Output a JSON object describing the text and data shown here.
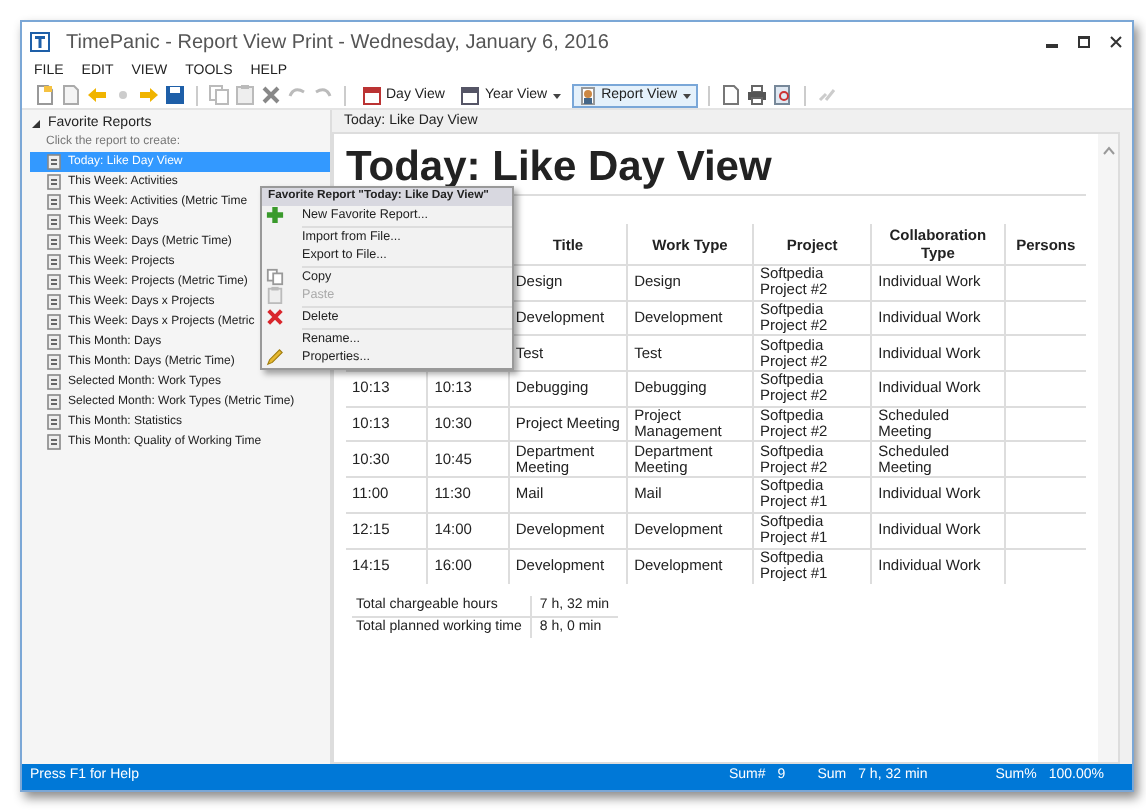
{
  "window": {
    "title": "TimePanic - Report View Print - Wednesday, January 6, 2016"
  },
  "menu_bar": [
    "FILE",
    "EDIT",
    "VIEW",
    "TOOLS",
    "HELP"
  ],
  "toolbar": {
    "view_buttons": [
      {
        "label": "Day View",
        "dropdown": false,
        "selected": false
      },
      {
        "label": "Year View",
        "dropdown": true,
        "selected": false
      },
      {
        "label": "Report View",
        "dropdown": true,
        "selected": true
      }
    ]
  },
  "sidebar": {
    "group": {
      "label": "Favorite Reports",
      "expanded": true,
      "hint": "Click the report to create:",
      "items": [
        {
          "label": "Today: Like Day View",
          "selected": true
        },
        {
          "label": "This Week: Activities",
          "selected": false
        },
        {
          "label": "This Week: Activities (Metric Time",
          "selected": false
        },
        {
          "label": "This Week: Days",
          "selected": false
        },
        {
          "label": "This Week: Days (Metric Time)",
          "selected": false
        },
        {
          "label": "This Week: Projects",
          "selected": false
        },
        {
          "label": "This Week: Projects (Metric Time)",
          "selected": false
        },
        {
          "label": "This Week: Days x Projects",
          "selected": false
        },
        {
          "label": "This Week: Days x Projects (Metric",
          "selected": false
        },
        {
          "label": "This Month: Days",
          "selected": false
        },
        {
          "label": "This Month: Days (Metric Time)",
          "selected": false
        },
        {
          "label": "Selected Month: Work Types",
          "selected": false
        },
        {
          "label": "Selected Month: Work Types (Metric Time)",
          "selected": false
        },
        {
          "label": "This Month: Statistics",
          "selected": false
        },
        {
          "label": "This Month: Quality of Working Time",
          "selected": false
        }
      ]
    }
  },
  "document_tab": {
    "title": "Today: Like Day View"
  },
  "report": {
    "title": "Today: Like Day View",
    "columns": {
      "title": "Title",
      "work_type": "Work Type",
      "project": "Project",
      "collaboration": "Collaboration Type",
      "persons": "Persons"
    },
    "rows": [
      {
        "title": "Design",
        "work_type": "Design",
        "project": "Softpedia Project #2",
        "collaboration": "Individual Work"
      },
      {
        "title": "Development",
        "work_type": "Development",
        "project": "Softpedia Project #2",
        "collaboration": "Individual Work"
      },
      {
        "title": "Test",
        "work_type": "Test",
        "project": "Softpedia Project #2",
        "collaboration": "Individual Work"
      },
      {
        "start": "10:13",
        "end": "10:13",
        "title": "Debugging",
        "work_type": "Debugging",
        "project": "Softpedia Project #2",
        "collaboration": "Individual Work"
      },
      {
        "start": "10:13",
        "end": "10:30",
        "title": "Project Meeting",
        "work_type": "Project Management",
        "project": "Softpedia Project #2",
        "collaboration": "Scheduled Meeting"
      },
      {
        "start": "10:30",
        "end": "10:45",
        "title": "Department Meeting",
        "work_type": "Department Meeting",
        "project": "Softpedia Project #2",
        "collaboration": "Scheduled Meeting"
      },
      {
        "start": "11:00",
        "end": "11:30",
        "title": "Mail",
        "work_type": "Mail",
        "project": "Softpedia Project #1",
        "collaboration": "Individual Work"
      },
      {
        "start": "12:15",
        "end": "14:00",
        "title": "Development",
        "work_type": "Development",
        "project": "Softpedia Project #1",
        "collaboration": "Individual Work"
      },
      {
        "start": "14:15",
        "end": "16:00",
        "title": "Development",
        "work_type": "Development",
        "project": "Softpedia Project #1",
        "collaboration": "Individual Work"
      }
    ],
    "totals": [
      {
        "label": "Total chargeable hours",
        "value": "7 h, 32 min"
      },
      {
        "label": "Total planned working time",
        "value": "8 h, 0 min"
      }
    ]
  },
  "context_menu": {
    "title": "Favorite Report \"Today: Like Day View\"",
    "items": [
      {
        "kind": "item",
        "label": "New Favorite Report...",
        "disabled": false
      },
      {
        "kind": "separator"
      },
      {
        "kind": "item",
        "label": "Import from File...",
        "disabled": false
      },
      {
        "kind": "item",
        "label": "Export to File...",
        "disabled": false
      },
      {
        "kind": "separator"
      },
      {
        "kind": "item",
        "label": "Copy",
        "disabled": false
      },
      {
        "kind": "item",
        "label": "Paste",
        "disabled": true
      },
      {
        "kind": "separator"
      },
      {
        "kind": "item",
        "label": "Delete",
        "disabled": false
      },
      {
        "kind": "separator"
      },
      {
        "kind": "item",
        "label": "Rename...",
        "disabled": false
      },
      {
        "kind": "item",
        "label": "Properties...",
        "disabled": false
      }
    ]
  },
  "status_bar": {
    "help": "Press F1 for Help",
    "sum_count_label": "Sum#",
    "sum_count": "9",
    "sum_label": "Sum",
    "sum": "7 h, 32 min",
    "sum_percent_label": "Sum%",
    "sum_percent": "100.00%"
  }
}
